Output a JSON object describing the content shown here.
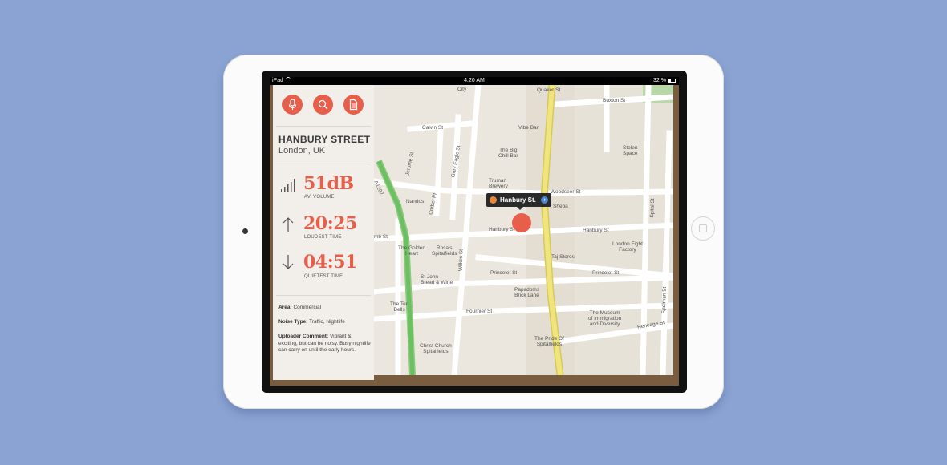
{
  "status_bar": {
    "device": "iPad",
    "time": "4:20 AM",
    "battery": "32 %",
    "battery_level": 0.32
  },
  "panel": {
    "buttons": [
      {
        "name": "microphone-button",
        "icon": "microphone-icon"
      },
      {
        "name": "search-button",
        "icon": "search-icon"
      },
      {
        "name": "document-button",
        "icon": "document-icon"
      }
    ],
    "location": {
      "street": "HANBURY STREET",
      "city": "London, UK"
    },
    "stats": [
      {
        "icon": "volume-bars-icon",
        "value": "51dB",
        "label": "AV. VOLUME"
      },
      {
        "icon": "arrow-up-icon",
        "value": "20:25",
        "label": "LOUDEST TIME"
      },
      {
        "icon": "arrow-down-icon",
        "value": "04:51",
        "label": "QUIETEST TIME"
      }
    ],
    "area": {
      "label": "Area:",
      "value": "Commercial"
    },
    "noise_type": {
      "label": "Noise Type:",
      "value": "Traffic, Nightlife"
    },
    "comment": {
      "label": "Uploader Comment:",
      "value": "Vibrant & exciting, but can be noisy. Busy nightlife can carry on until the early hours."
    }
  },
  "map": {
    "callout_label": "Hanbury St.",
    "streets": {
      "quaker": "Quaker St",
      "buxton": "Buxton St",
      "calvin": "Calvin St",
      "jerome": "Jerome St",
      "grey_eagle": "Grey Eagle St",
      "corbet": "Corbet Pl",
      "a1202": "A1202",
      "woodseer": "Woodseer St",
      "hanbury_right": "Hanbury St",
      "hanbury_mid": "Hanbury St",
      "hanbury_left": "mb St",
      "wilkes": "Wilkes St",
      "princelet_left": "Princelet St",
      "princelet_right": "Princelet St",
      "fournier": "Fournier St",
      "heneage": "Heneage St",
      "spital": "Spital St",
      "spelman": "Spelman St"
    },
    "places": {
      "city": "City",
      "vibe_bar": "Vibe Bar",
      "big_chill": "The Big\nChill Bar",
      "truman": "Truman\nBrewery",
      "sheba": "Sheba",
      "nandos": "Nandos",
      "stolen_space": "Stolen\nSpace",
      "golden_heart": "The Golden\nHeart",
      "rosas": "Rosa's\nSpitalfields",
      "taj": "Taj Stores",
      "london_fight": "London Fight\nFactory",
      "st_john": "St John\nBread & Wine",
      "papadoms": "Papadoms\nBrick Lane",
      "ten_bells": "The Ten\nBells",
      "museum": "The Museum\nof Immigration\nand Diversity",
      "christ_church": "Christ Church\nSpitalfields",
      "pride": "The Pride Of\nSpitalfields"
    }
  }
}
